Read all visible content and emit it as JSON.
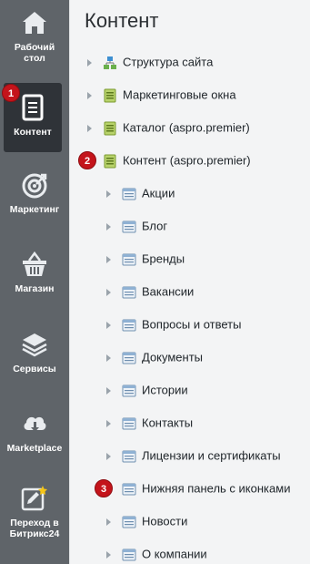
{
  "nav": {
    "items": [
      {
        "label_line1": "Рабочий",
        "label_line2": "стол"
      },
      {
        "label_line1": "Контент",
        "label_line2": ""
      },
      {
        "label_line1": "Маркетинг",
        "label_line2": ""
      },
      {
        "label_line1": "Магазин",
        "label_line2": ""
      },
      {
        "label_line1": "Сервисы",
        "label_line2": ""
      },
      {
        "label_line1": "Marketplace",
        "label_line2": ""
      },
      {
        "label_line1": "Переход в",
        "label_line2": "Битрикс24"
      }
    ],
    "badge": "1"
  },
  "main": {
    "title": "Контент",
    "tree": [
      {
        "label": "Структура сайта",
        "icon": "site-structure-icon"
      },
      {
        "label": "Маркетинговые окна",
        "icon": "iblock-type-icon"
      },
      {
        "label": "Каталог (aspro.premier)",
        "icon": "iblock-type-icon"
      },
      {
        "label": "Контент (aspro.premier)",
        "icon": "iblock-type-icon"
      },
      {
        "label": "Акции",
        "icon": "iblock-icon"
      },
      {
        "label": "Блог",
        "icon": "iblock-icon"
      },
      {
        "label": "Бренды",
        "icon": "iblock-icon"
      },
      {
        "label": "Вакансии",
        "icon": "iblock-icon"
      },
      {
        "label": "Вопросы и ответы",
        "icon": "iblock-icon"
      },
      {
        "label": "Документы",
        "icon": "iblock-icon"
      },
      {
        "label": "Истории",
        "icon": "iblock-icon"
      },
      {
        "label": "Контакты",
        "icon": "iblock-icon"
      },
      {
        "label": "Лицензии и сертификаты",
        "icon": "iblock-icon"
      },
      {
        "label": "Нижняя панель с иконками",
        "icon": "iblock-icon"
      },
      {
        "label": "Новости",
        "icon": "iblock-icon"
      },
      {
        "label": "О компании",
        "icon": "iblock-icon"
      }
    ],
    "badges": [
      "2",
      "3"
    ]
  },
  "colors": {
    "nav_bg": "#5f6469",
    "nav_active_bg": "#2f3338",
    "badge_red": "#c4141b",
    "content_bg": "#f3f4f5"
  }
}
